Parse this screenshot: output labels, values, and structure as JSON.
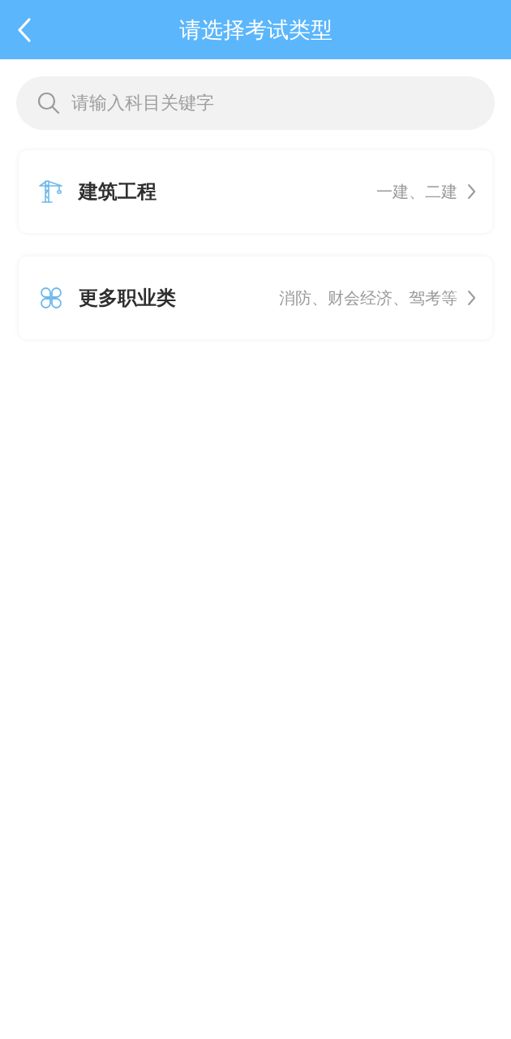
{
  "header": {
    "title": "请选择考试类型"
  },
  "search": {
    "placeholder": "请输入科目关键字"
  },
  "categories": [
    {
      "kind": "crane",
      "title": "建筑工程",
      "subtitle": "一建、二建"
    },
    {
      "kind": "clover",
      "title": "更多职业类",
      "subtitle": "消防、财会经济、驾考等"
    }
  ]
}
